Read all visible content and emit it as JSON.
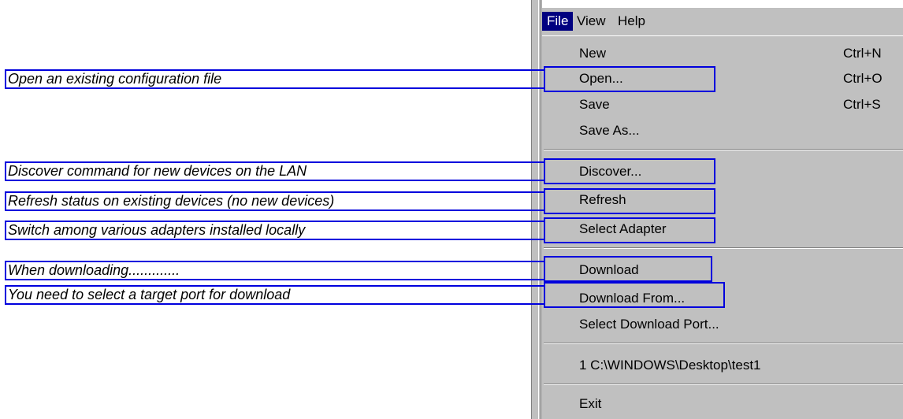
{
  "menubar": {
    "file": "File",
    "view": "View",
    "help": "Help"
  },
  "menu": {
    "new": "New",
    "new_shortcut": "Ctrl+N",
    "open": "Open...",
    "open_shortcut": "Ctrl+O",
    "save": "Save",
    "save_shortcut": "Ctrl+S",
    "save_as": "Save As...",
    "discover": "Discover...",
    "refresh": "Refresh",
    "select_adapter": "Select Adapter",
    "download": "Download",
    "download_from": "Download From...",
    "select_download_port": "Select Download Port...",
    "recent_file": "1 C:\\WINDOWS\\Desktop\\test1",
    "exit": "Exit"
  },
  "annotations": {
    "open": "Open an existing configuration file",
    "discover": "Discover command for new devices on the LAN",
    "refresh": "Refresh status on existing devices  (no new devices)",
    "select_adapter": "Switch among various adapters installed locally",
    "download": "When downloading.............",
    "download_from": "You need to select a target port for download"
  },
  "colors": {
    "menu_background": "#c0c0c0",
    "highlight": "#000080",
    "callout_border": "#0000dd"
  }
}
